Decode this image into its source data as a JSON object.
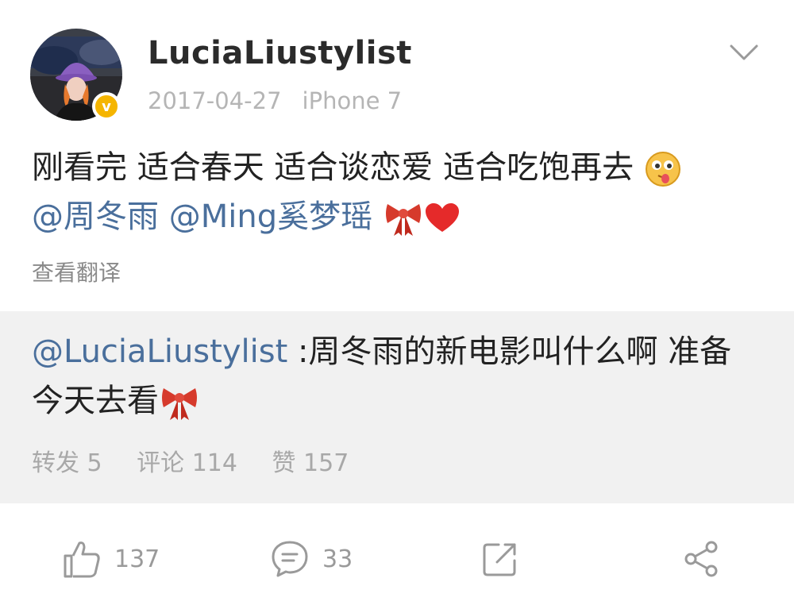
{
  "post": {
    "username": "LuciaLiustylist",
    "date": "2017-04-27",
    "device": "iPhone 7",
    "text": "刚看完 适合春天 适合谈恋爱 适合吃饱再去",
    "mention_1": "@周冬雨",
    "mention_2": "@Ming奚梦瑶",
    "translate_label": "查看翻译",
    "emojis": [
      "tongue-out-face-emoji",
      "ribbon-emoji",
      "heart-emoji"
    ]
  },
  "repost": {
    "mention": "@LuciaLiustylist",
    "text": ":周冬雨的新电影叫什么啊 准备今天去看",
    "stats": {
      "forward": "转发 5",
      "comment": "评论 114",
      "like": "赞 157"
    }
  },
  "actions": {
    "like_count": "137",
    "comment_count": "33",
    "icons": [
      "thumbs-up-icon",
      "comment-icon",
      "repost-icon",
      "share-icon"
    ]
  },
  "colors": {
    "mention": "#4a6f9c",
    "badge": "#f5b500",
    "repost_bg": "#f1f1f1"
  }
}
